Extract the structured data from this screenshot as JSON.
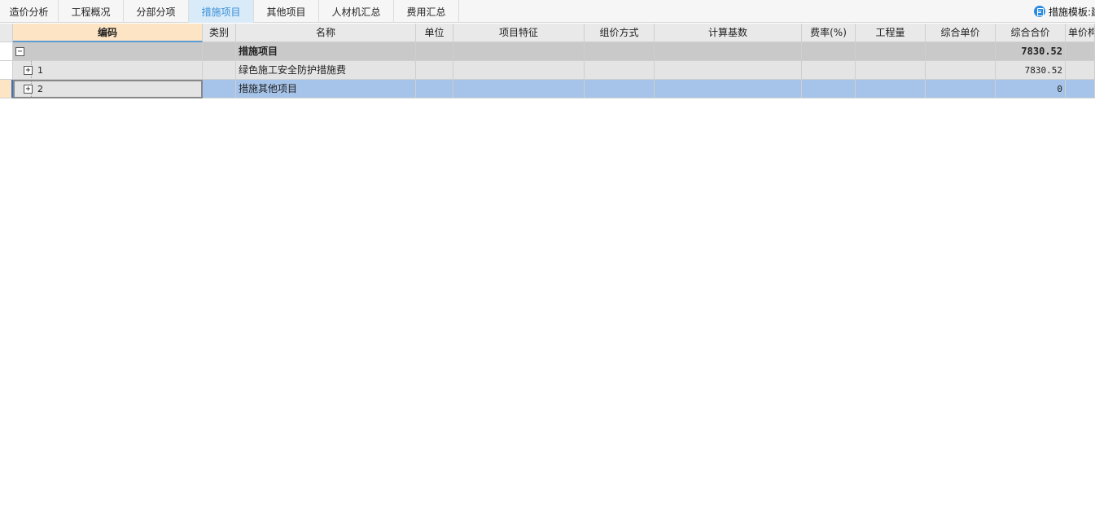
{
  "tabs": [
    {
      "label": "造价分析"
    },
    {
      "label": "工程概况"
    },
    {
      "label": "分部分项"
    },
    {
      "label": "措施项目"
    },
    {
      "label": "其他项目"
    },
    {
      "label": "人材机汇总"
    },
    {
      "label": "费用汇总"
    }
  ],
  "active_tab": "措施项目",
  "template_label": "措施模板:建",
  "columns": {
    "code": "编码",
    "type": "类别",
    "name": "名称",
    "unit": "单位",
    "feature": "项目特征",
    "price_method": "组价方式",
    "base": "计算基数",
    "rate": "费率(%)",
    "quantity": "工程量",
    "unit_price": "综合单价",
    "total": "综合合价",
    "unit_price_extra": "单价构成"
  },
  "rows": [
    {
      "code": "",
      "name": "措施项目",
      "total": "7830.52",
      "tree": "−"
    },
    {
      "code": "1",
      "name": "绿色施工安全防护措施费",
      "total": "7830.52",
      "tree": "+"
    },
    {
      "code": "2",
      "name": "措施其他项目",
      "total": "0",
      "tree": "+"
    }
  ],
  "colors": {
    "active_tab_bg": "#d9ebf9",
    "active_tab_text": "#3a8fd6",
    "code_header_bg": "#fde4c4",
    "selected_row_bg": "#a6c4e9",
    "group_row_bg": "#c9c9c9"
  }
}
